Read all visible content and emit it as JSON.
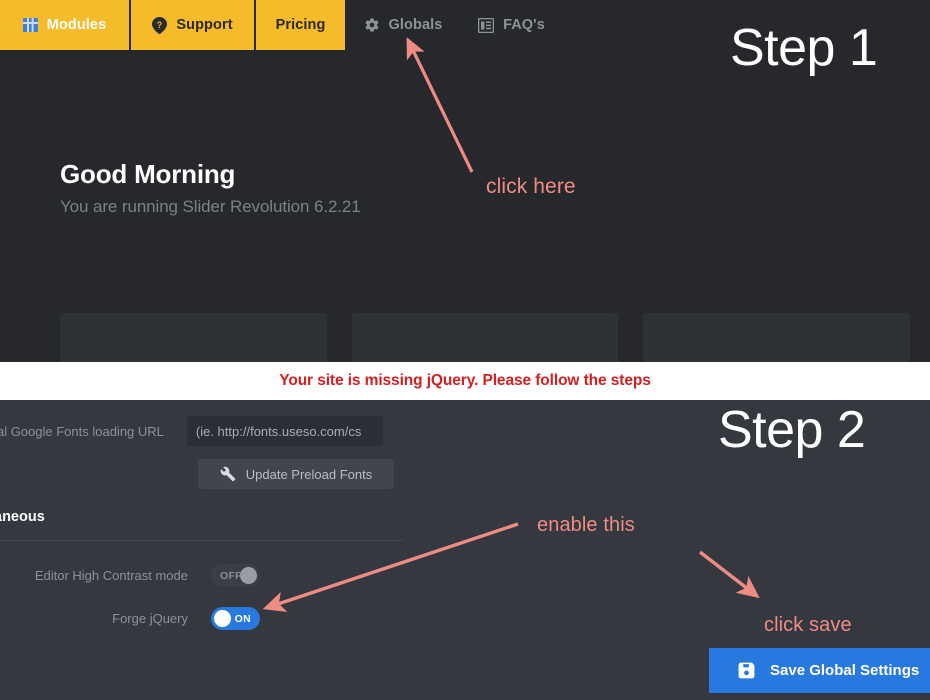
{
  "top_panel": {
    "nav_tabs": [
      {
        "label": "Modules",
        "icon": "grid-icon",
        "state": "active"
      },
      {
        "label": "Support",
        "icon": "question-pin-icon",
        "state": "active"
      },
      {
        "label": "Pricing",
        "icon": "",
        "state": "active"
      },
      {
        "label": "Globals",
        "icon": "gear-icon",
        "state": "inactive"
      },
      {
        "label": "FAQ's",
        "icon": "book-icon",
        "state": "inactive"
      }
    ],
    "greeting_title": "Good Morning",
    "greeting_subtitle": "You are running Slider Revolution 6.2.21",
    "step_label": "Step 1",
    "cards": [
      {
        "glyph": "☷"
      },
      {
        "glyph": "◢"
      },
      {
        "glyph": "△"
      }
    ]
  },
  "banner": {
    "message": "Your site is missing jQuery. Please follow the steps",
    "color": "#d11f22"
  },
  "bottom_panel": {
    "step_label": "Step 2",
    "fonts_row": {
      "label": "tional Google Fonts loading URL",
      "input_value": "",
      "input_placeholder": "(ie. http://fonts.useso.com/cs"
    },
    "preload_button": {
      "label": "Update Preload Fonts",
      "icon": "wrench-icon"
    },
    "section_header": "aneous",
    "toggles": [
      {
        "label": "Editor High Contrast mode",
        "state": "OFF",
        "on": false
      },
      {
        "label": "Forge jQuery",
        "state": "ON",
        "on": true
      }
    ],
    "save_button": {
      "label": "Save Global Settings",
      "icon": "save-floppy-icon",
      "color": "#2779e0"
    }
  },
  "annotations": {
    "accent_color": "#ef8b85",
    "click_here": "click here",
    "enable_this": "enable this",
    "click_save": "click save"
  }
}
